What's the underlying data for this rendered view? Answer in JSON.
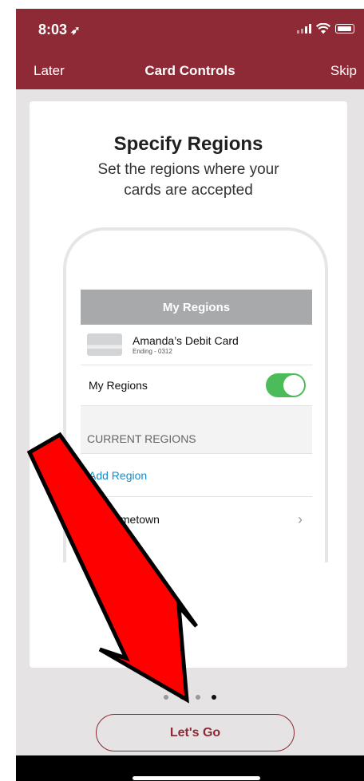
{
  "status_bar": {
    "time": "8:03",
    "location_arrow": "location-arrow-icon",
    "signal": "signal-icon",
    "wifi": "wifi-icon",
    "battery": "battery-icon"
  },
  "nav": {
    "left": "Later",
    "title": "Card Controls",
    "right": "Skip"
  },
  "card": {
    "title": "Specify Regions",
    "subtitle": "Set the regions where your cards are accepted"
  },
  "mockup": {
    "header": "My Regions",
    "card_name": "Amanda’s Debit Card",
    "card_ending": "Ending - 0312",
    "toggle_label": "My Regions",
    "toggle_on": true,
    "section_label": "CURRENT REGIONS",
    "add_region": "Add Region",
    "region_item": "Hometown"
  },
  "pager": {
    "count": 4,
    "active": 4
  },
  "cta": {
    "label": "Let's Go"
  },
  "colors": {
    "brand": "#8e2a35",
    "toggle": "#4cbb59",
    "link": "#1a8ac4",
    "annotation_arrow": "#ff0000"
  }
}
